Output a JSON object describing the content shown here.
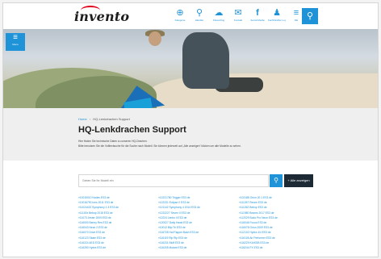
{
  "header": {
    "logo": "invento",
    "nav": [
      {
        "icon": "info-icon",
        "glyph": "⊕",
        "label": "Kategorie"
      },
      {
        "icon": "location-icon",
        "glyph": "⚲",
        "label": "Händler"
      },
      {
        "icon": "chat-icon",
        "glyph": "☁",
        "label": "Kitesurfing"
      },
      {
        "icon": "support-icon",
        "glyph": "✉",
        "label": "Kontakt"
      },
      {
        "icon": "facebook-icon",
        "glyph": "f",
        "label": "Social Media"
      },
      {
        "icon": "user-icon",
        "glyph": "♟",
        "label": "Fachhändler Login"
      },
      {
        "icon": "language-icon",
        "glyph": "≡",
        "label": "DE"
      }
    ],
    "search_glyph": "⚲"
  },
  "menu": {
    "glyph": "≡",
    "label": "Menu"
  },
  "breadcrumb": {
    "home": "Home",
    "separator": "›",
    "current": "HQ-Lenkdrachen Support"
  },
  "title": "HQ-Lenkdrachen Support",
  "intro_lines": [
    "Hier finden Sie technische Daten zu unseren HQ-Drachen.",
    "Bitte benutzen Sie die Volltextsuche für die Suche nach Modell. Sie können jederzeit auf „Alle anzeigen“ klicken um alle Modelle zu sehen."
  ],
  "search": {
    "placeholder": "Geben Sie Ihr Modell ein",
    "go_glyph": "⚲",
    "show_all": "+ Alle anzeigen"
  },
  "models": {
    "col1": [
      "»10015010 Nodes ES3 de",
      "»10016790 Ines 2011 ES3 de",
      "»11024422 Symphony 1.3 ES3 de",
      "»11100x Bebop 2018 ES3 de",
      "»11073 Jester 2009 ES3 de",
      "»116000 Benny Res ES3 de",
      "»116043 Neon 2 ES3 de",
      "»116070 Drive ES3 de",
      "»116123 Skate ES3 de",
      "»116224 AED ES3 de",
      "»116250 Hydra ES3 de"
    ],
    "col2": [
      "»12221780 Trigger ES3 de",
      "»122231 Eclipse II ES3 de",
      "»121142 Symphony 4 2014 ES3 de",
      "»1222227 Seven II ES3 de",
      "»12224 Limbo II ES3 de",
      "»120027 Daily Hawk ES3 de",
      "»10012 Blip Tri ES3 de",
      "»116728 Hal Papper Bash ES3 de",
      "»116119 Rip Rip ES3 de",
      "»116231 Bluff ES3 de",
      "»116205 Mutant ES3 de"
    ],
    "col3": [
      "»102188 Orion 20.1 ES3 de",
      "»111267 Reone ES3 de",
      "»111262 Bebop ES3 de",
      "»111980 Beams 2017 ES3 de",
      "»112029 Bodo Pro Neon ES3 de",
      "»116046 Focus ES3 de",
      "»116078 Orion 2009 ES3 de",
      "»112102 Hydra 4/4 ES3 de",
      "»116106 Air Performer ES3 de",
      "»116229 KA/KSB ES3 de",
      "»116244 FX ES3 de"
    ]
  }
}
